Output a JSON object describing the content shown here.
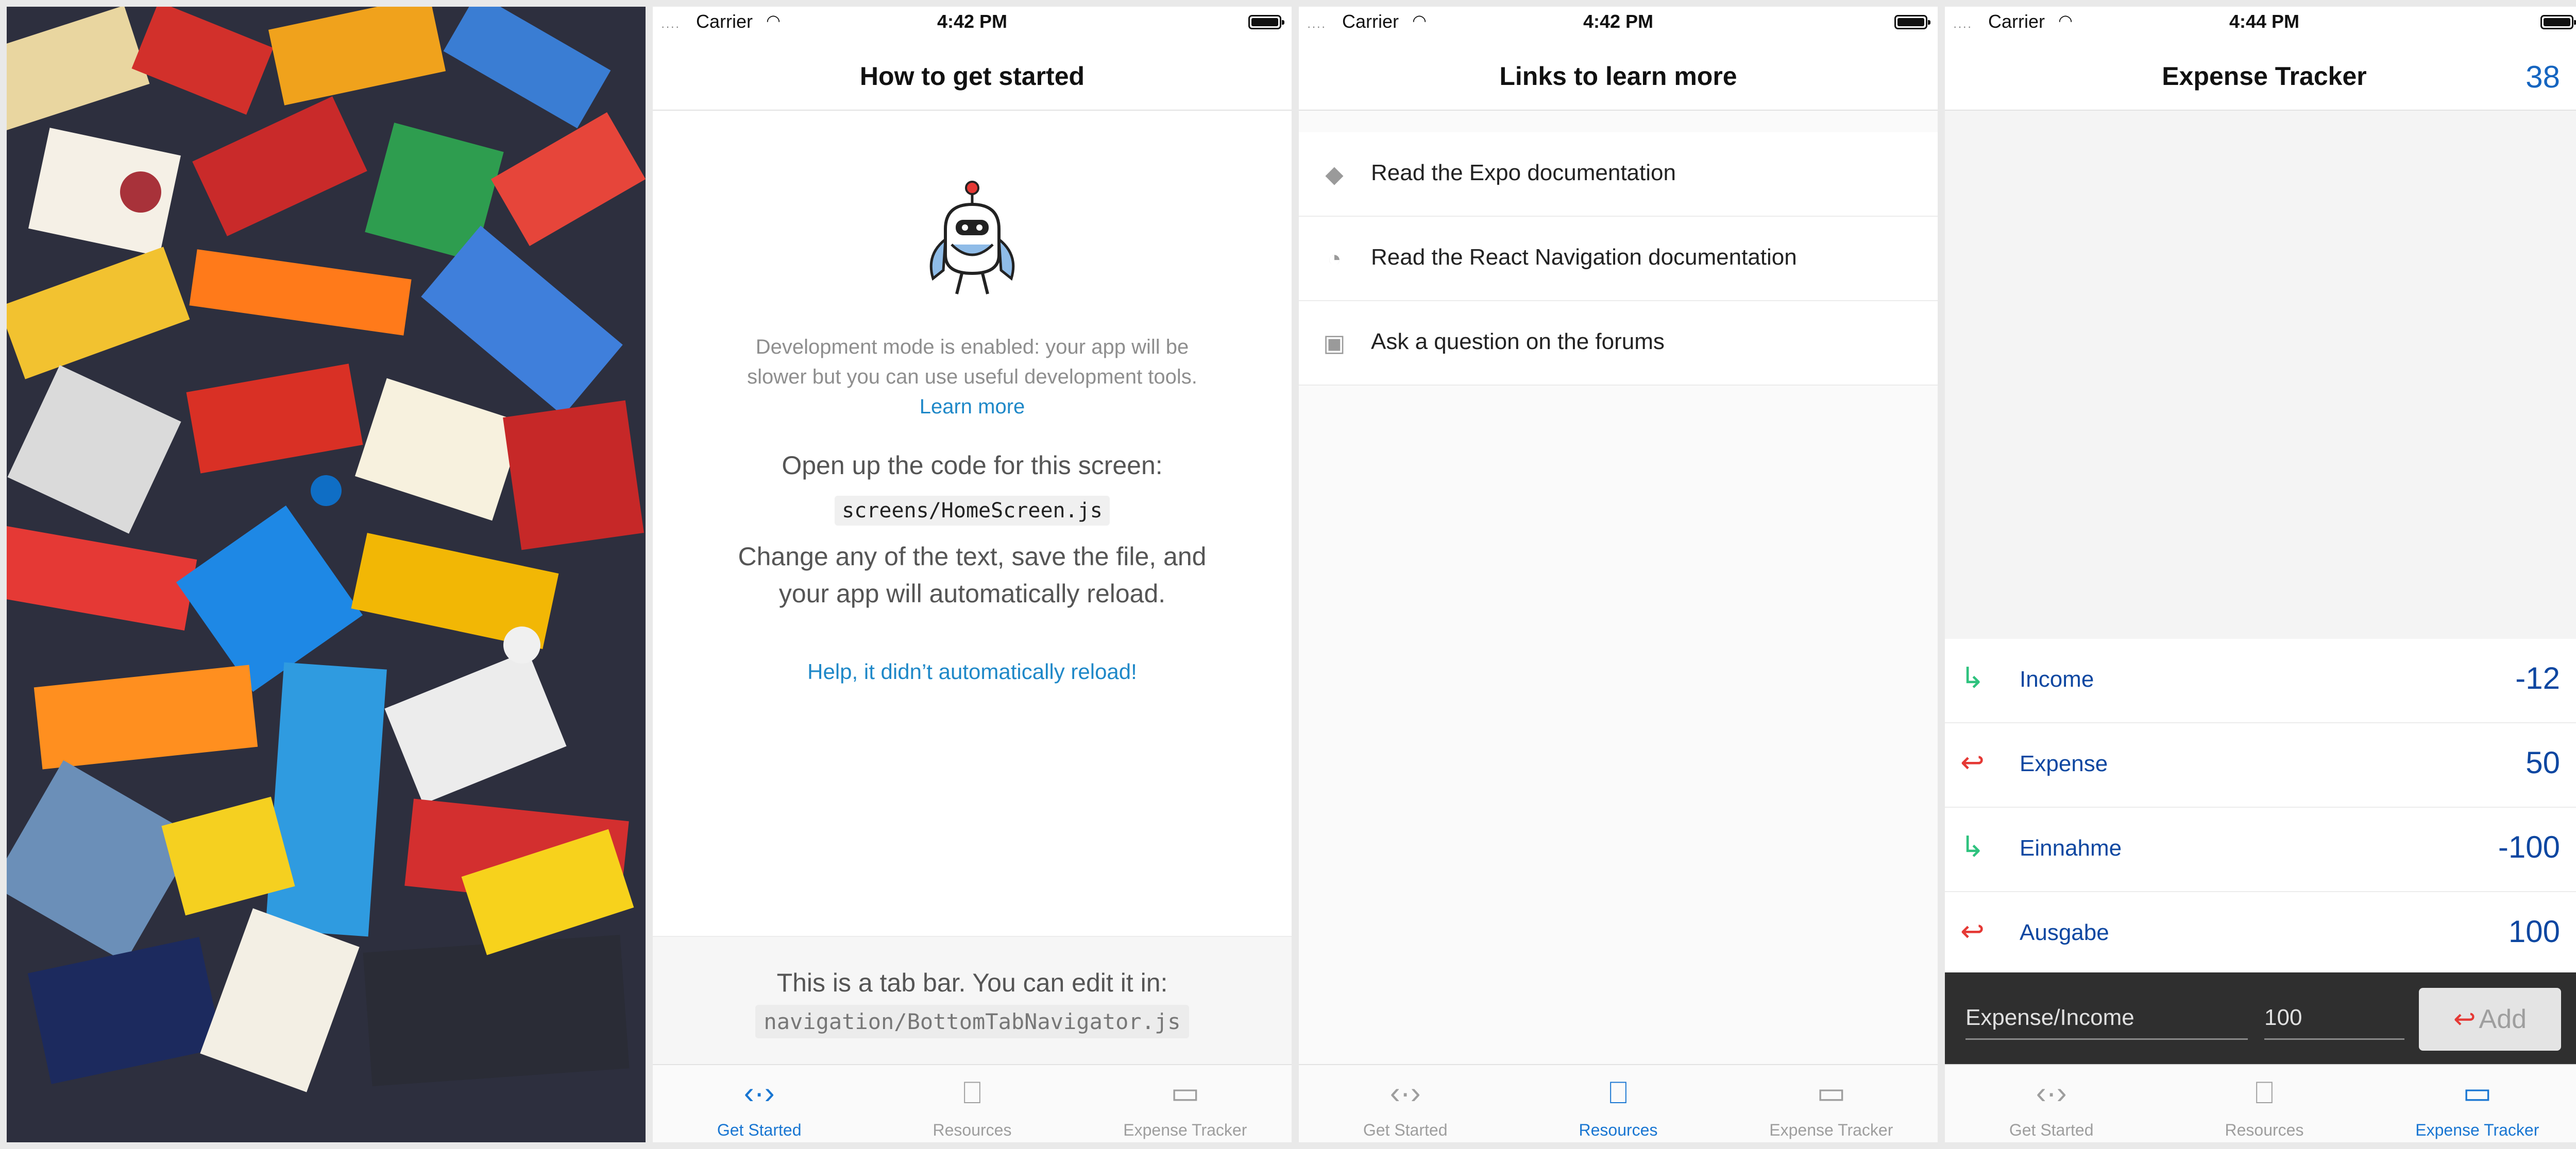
{
  "status_bar": {
    "carrier": "Carrier",
    "signal": "····",
    "wifi": "◠",
    "times": [
      "4:42 PM",
      "4:42 PM",
      "4:44 PM"
    ]
  },
  "tabs": [
    {
      "label": "Get Started",
      "icon": "code-icon",
      "glyph": "‹·›"
    },
    {
      "label": "Resources",
      "icon": "book-icon",
      "glyph": "⎕"
    },
    {
      "label": "Expense Tracker",
      "icon": "money-icon",
      "glyph": "▭"
    }
  ],
  "colors": {
    "accent": "#1976d2",
    "income": "#2ec27e",
    "expense": "#e53935",
    "value_text": "#0d47a1"
  },
  "get_started": {
    "title": "How to get started",
    "dev_text": "Development mode is enabled: your app will be slower but you can use useful development tools.",
    "learn_more": "Learn more",
    "open_up": "Open up the code for this screen:",
    "file_path": "screens/HomeScreen.js",
    "change_text": "Change any of the text, save the file, and your app will automatically reload.",
    "help_link": "Help, it didn’t automatically reload!",
    "tabbar_info": "This is a tab bar. You can edit it in:",
    "tabbar_path": "navigation/BottomTabNavigator.js"
  },
  "resources": {
    "title": "Links to learn more",
    "items": [
      {
        "label": "Read the Expo documentation",
        "icon": "graduation-cap-icon",
        "glyph": "◆"
      },
      {
        "label": "Read the React Navigation documentation",
        "icon": "compass-icon",
        "glyph": "◔"
      },
      {
        "label": "Ask a question on the forums",
        "icon": "chat-icon",
        "glyph": "▣"
      }
    ]
  },
  "expense": {
    "title": "Expense Tracker",
    "total": "38",
    "rows": [
      {
        "name": "Income",
        "value": "-12",
        "type": "income",
        "glyph": "↳"
      },
      {
        "name": "Expense",
        "value": "50",
        "type": "expense",
        "glyph": "↩"
      },
      {
        "name": "Einnahme",
        "value": "-100",
        "type": "income",
        "glyph": "↳"
      },
      {
        "name": "Ausgabe",
        "value": "100",
        "type": "expense",
        "glyph": "↩"
      }
    ],
    "input_label": "Expense/Income",
    "amount_value": "100",
    "add_label": "Add",
    "add_glyph": "↩"
  }
}
